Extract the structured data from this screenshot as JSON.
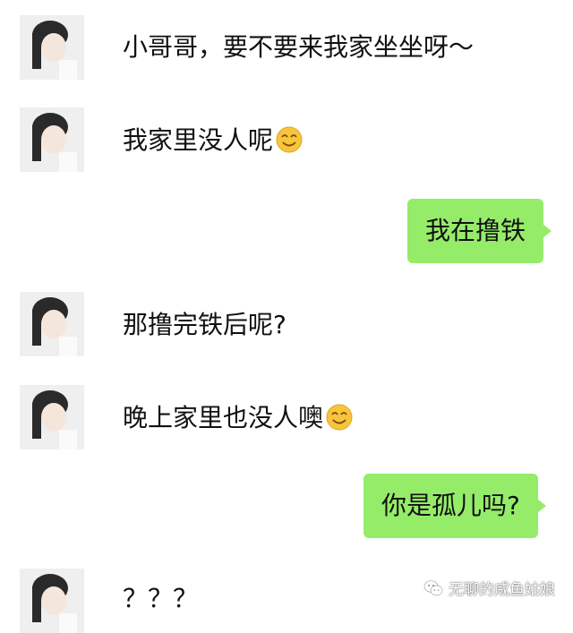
{
  "conversation": {
    "messages": [
      {
        "sender": "contact",
        "text": "小哥哥，要不要来我家坐坐呀～"
      },
      {
        "sender": "contact",
        "text": "我家里没人呢",
        "emoji": "smiling-face-with-heart-eyes-icon"
      },
      {
        "sender": "self",
        "text": "我在撸铁"
      },
      {
        "sender": "contact",
        "text": "那撸完铁后呢?"
      },
      {
        "sender": "contact",
        "text": "晚上家里也没人噢",
        "emoji": "smiling-face-with-heart-eyes-icon"
      },
      {
        "sender": "self",
        "text": "你是孤儿吗?"
      },
      {
        "sender": "contact",
        "text": "？？？"
      }
    ]
  },
  "watermark": {
    "text": "无聊的咸鱼姑娘",
    "icon": "wechat-icon"
  },
  "colors": {
    "self_bubble": "#95ec69",
    "background": "#ffffff"
  }
}
